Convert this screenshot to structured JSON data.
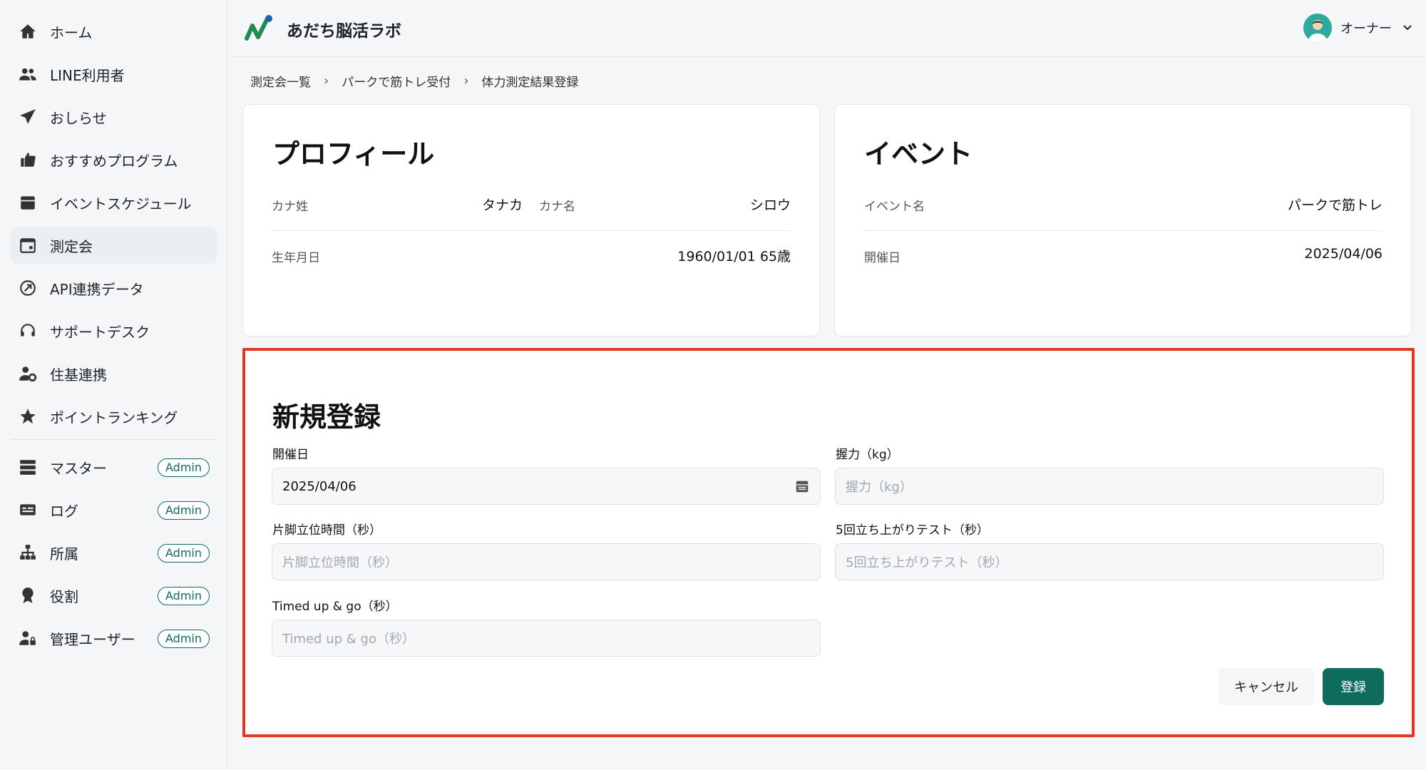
{
  "colors": {
    "accent": "#0f6b5c",
    "highlight_border": "#e23a22"
  },
  "sidebar": {
    "items": [
      {
        "label": "ホーム",
        "icon": "home-icon"
      },
      {
        "label": "LINE利用者",
        "icon": "users-icon"
      },
      {
        "label": "おしらせ",
        "icon": "send-icon"
      },
      {
        "label": "おすすめプログラム",
        "icon": "thumbs-up-icon"
      },
      {
        "label": "イベントスケジュール",
        "icon": "calendar-icon"
      },
      {
        "label": "測定会",
        "icon": "calendar-outline-icon",
        "active": true
      },
      {
        "label": "API連携データ",
        "icon": "api-icon"
      },
      {
        "label": "サポートデスク",
        "icon": "headset-icon"
      },
      {
        "label": "住基連携",
        "icon": "user-gear-icon"
      },
      {
        "label": "ポイントランキング",
        "icon": "star-icon"
      }
    ],
    "admin_items": [
      {
        "label": "マスター",
        "badge": "Admin",
        "icon": "database-icon"
      },
      {
        "label": "ログ",
        "badge": "Admin",
        "icon": "log-icon"
      },
      {
        "label": "所属",
        "badge": "Admin",
        "icon": "sitemap-icon"
      },
      {
        "label": "役割",
        "badge": "Admin",
        "icon": "award-icon"
      },
      {
        "label": "管理ユーザー",
        "badge": "Admin",
        "icon": "user-lock-icon"
      }
    ]
  },
  "header": {
    "brand": "あだち脳活ラボ",
    "user": "オーナー"
  },
  "breadcrumb": [
    "測定会一覧",
    "パークで筋トレ受付",
    "体力測定結果登録"
  ],
  "profile": {
    "title": "プロフィール",
    "kana_last_label": "カナ姓",
    "kana_last": "タナカ",
    "kana_first_label": "カナ名",
    "kana_first": "シロウ",
    "birth_label": "生年月日",
    "birth": "1960/01/01 65歳"
  },
  "event": {
    "title": "イベント",
    "name_label": "イベント名",
    "name": "パークで筋トレ",
    "date_label": "開催日",
    "date": "2025/04/06"
  },
  "form": {
    "title": "新規登録",
    "date_label": "開催日",
    "date_value": "2025/04/06",
    "grip_label": "握力（kg）",
    "grip_placeholder": "握力（kg）",
    "one_leg_label": "片脚立位時間（秒）",
    "one_leg_placeholder": "片脚立位時間（秒）",
    "stand_label": "5回立ち上がりテスト（秒）",
    "stand_placeholder": "5回立ち上がりテスト（秒）",
    "tug_label": "Timed up & go（秒）",
    "tug_placeholder": "Timed up & go（秒）",
    "cancel": "キャンセル",
    "submit": "登録"
  }
}
